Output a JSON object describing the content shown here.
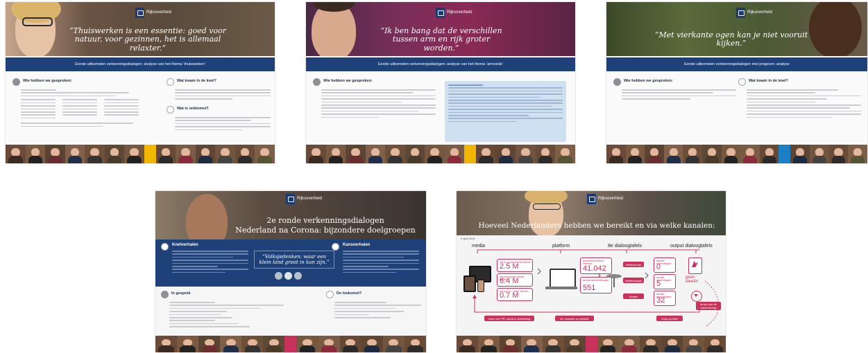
{
  "brand": "Rijksoverheid",
  "slides": [
    {
      "quote": "“Thuiswerken is een essentie: goed voor natuur, voor gezinnen, het is allemaal relaxter.”",
      "band": "Eerste uitkomsten verkenningsdialogen: analyse van het thema ‘thuiswerken’",
      "left_title": "Wie hebben we gesproken:",
      "right_title_1": "Wat kwam in de knel?",
      "right_title_2": "Wat is ontkomst?"
    },
    {
      "quote": "“Ik ben bang dat de verschillen tussen arm en rijk groter worden.”",
      "band": "Eerste uitkomsten verkenningsdialogen: analyse van het thema ‘armoede’",
      "left_title": "Wie hebben we gesproken:"
    },
    {
      "quote": "“Met vierkante ogen kan je niet vooruit kijken.”",
      "band": "Eerste uitkomsten verkenningsdialogen met jongeren: analyse",
      "left_title": "Wie hebben we gesproken:",
      "right_title_1": "Wat kwam in de knel?"
    },
    {
      "title_line1": "2e ronde verkenningsdialogen",
      "title_line2": "Nederland na Corona: bijzondere doelgroepen",
      "left_block_title": "Knelverhalen",
      "right_block_title": "Kansverhalen",
      "mid_quote": "“Volksjedenken: waar een klein land groot in kan zijn.”",
      "gesprek_title": "In gesprek",
      "toekomst_title": "De toekomst?"
    },
    {
      "title": "Hoeveel Nederlanders hebben we bereikt en via welke kanalen:",
      "date": "9 april 2021",
      "columns": [
        "media",
        "platform",
        "8e dialoogtafels",
        "output dialoogtafels"
      ],
      "media_stats": [
        {
          "label": "PR & social media bereik",
          "value": "2.5 M"
        },
        {
          "label": "Inkoop social media bereik",
          "value": "6.4 M"
        },
        {
          "label": "Inkoop tv / radio bereik",
          "value": "0.7 M"
        }
      ],
      "platform_stats": [
        {
          "label": "aantal bezoekers website",
          "value": "41.042"
        },
        {
          "label": "aantal aanmeldingen",
          "value": "551"
        }
      ],
      "table_labels": [
        "Wetenschap",
        "Maatschappij",
        "Burger"
      ],
      "output_stats": [
        {
          "label": "aantal inzendingen",
          "value": "0"
        },
        {
          "label": "aantal inzendingen",
          "value": "5"
        },
        {
          "label": "aantal inzendingen",
          "value": "32"
        }
      ],
      "ideas_label": "geen ideeën",
      "bottom_pills": [
        "Inzet van: PR, social & advertising",
        "dit: contacts op website",
        "terug op tafel"
      ],
      "side_pill": "terug naar de samenleving"
    }
  ]
}
